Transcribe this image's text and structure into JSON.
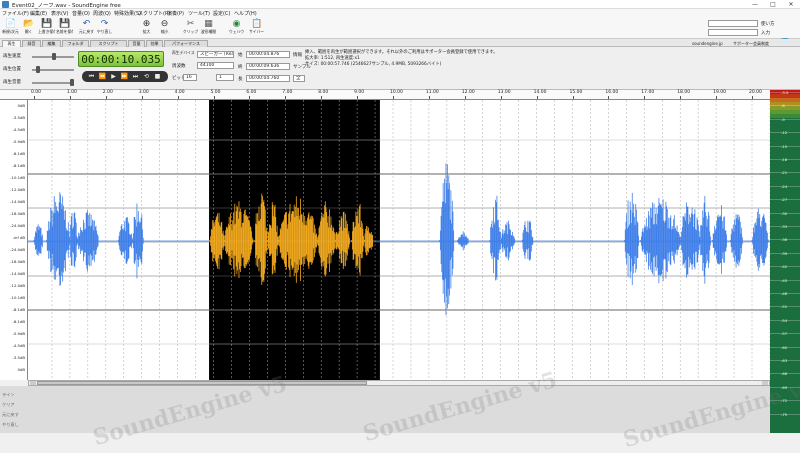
{
  "window": {
    "title": "Event02_ノーフ.wav - SoundEngine free",
    "min": "—",
    "max": "□",
    "close": "✕"
  },
  "menu": [
    "ファイル(F)",
    "編集(E)",
    "表示(V)",
    "音量(O)",
    "周波(Q)",
    "特殊効果(S)",
    "スクリプト(R)",
    "演奏(P)",
    "ツール(T)",
    "設定(C)",
    "ヘルプ(H)"
  ],
  "toolbar": [
    {
      "icon": "📄",
      "label": "新規/次元",
      "color": "#555"
    },
    {
      "icon": "📂",
      "label": "開く",
      "color": "#d4a020"
    },
    {
      "icon": "💾",
      "label": "上書き保存",
      "color": "#3a6fb0"
    },
    {
      "icon": "💾",
      "label": "名前を保存",
      "color": "#3a6fb0"
    },
    {
      "icon": "↶",
      "label": "元に戻す",
      "color": "#2a5fb0"
    },
    {
      "icon": "↷",
      "label": "やり直し",
      "color": "#2a5fb0"
    },
    {
      "icon": "⊕",
      "label": "拡大",
      "color": "#333"
    },
    {
      "icon": "⊖",
      "label": "縮小",
      "color": "#333"
    },
    {
      "icon": "✂",
      "label": "クリップ",
      "color": "#555"
    },
    {
      "icon": "▦",
      "label": "波形補間",
      "color": "#555"
    },
    {
      "icon": "◉",
      "label": "ウェハウ",
      "color": "#1f8c3a"
    },
    {
      "icon": "📋",
      "label": "サイバー",
      "color": "#555"
    }
  ],
  "right_header": {
    "field1": "",
    "field2": "",
    "label1": "使い方",
    "label2": "入力",
    "brand": "soundengine.jp",
    "member": "サポーター会員制度"
  },
  "tabs": [
    "再生",
    "録音",
    "編集",
    "フォルダ",
    "スクリプト",
    "音量",
    "効果",
    "パフォーマンス"
  ],
  "controls": {
    "labels": [
      "再生速度",
      "再生位置",
      "再生音量"
    ],
    "main_time": "00:00:10.035",
    "device_label": "再生デバイス",
    "device_value": "スピーカー (Realt",
    "rate_label": "周波数",
    "rate_value": "44100",
    "bits_label": "ビット",
    "bits_value": "16",
    "ch_value": "1",
    "mode_value": "全",
    "t_start_label": "始",
    "t_start": "00:00:04.876",
    "t_end_label": "終",
    "t_end": "00:00:09.636",
    "t_len_label": "長",
    "t_len": "00:00:04.760",
    "info_tag": "情報",
    "sample_tag": "サンプル"
  },
  "transport": [
    "⏮",
    "⏪",
    "▶",
    "⏩",
    "⏭",
    "⟲",
    "■"
  ],
  "info": [
    "挿入、範囲を再生が範囲選択ができます。それ以外のご利用はサポーター会員登録で使用できます。",
    "拡大率: 1:512, 再生速度:x1",
    "サイズ: 00:00:57.746 (2546627サンプル, 4.9MB, 5093266バイト)"
  ],
  "ruler": [
    "0.00",
    "1.00",
    "2.00",
    "3.00",
    "4.00",
    "5.00",
    "6.00",
    "7.00",
    "8.00",
    "9.00",
    "10.00",
    "11.00",
    "12.00",
    "13.00",
    "14.00",
    "15.00",
    "16.00",
    "17.00",
    "18.00",
    "19.00",
    "20.00"
  ],
  "db_labels": [
    "0dB",
    "-3.5dB",
    "-4.5dB",
    "-5.9dB",
    "-6.1dB",
    "-8.1dB",
    "-10.1dB",
    "-12.0dB",
    "-14.0dB",
    "-18.0dB",
    "-24.0dB",
    "-inf dB",
    "-24.0dB",
    "-18.0dB",
    "-14.0dB",
    "-12.0dB",
    "-10.1dB",
    "-8.1dB",
    "-6.1dB",
    "-5.9dB",
    "-4.5dB",
    "-3.5dB",
    "0dB"
  ],
  "meter_labels": [
    "-3.5",
    "-6",
    "-9",
    "-12",
    "-15",
    "-18",
    "-21",
    "-24",
    "-27",
    "-30",
    "-33",
    "-36",
    "-39",
    "-42",
    "-45",
    "-48",
    "-51",
    "-54",
    "-57",
    "-60",
    "-63",
    "-66",
    "-69",
    "-72",
    "-75"
  ],
  "side_labels": [
    "ライン",
    "クリア",
    "元に戻す",
    "やり直し"
  ],
  "watermark": "SoundEngine v5",
  "colors": {
    "wave": "#3f7fe8",
    "selected_wave": "#f0a81e",
    "selection_bg": "#000000",
    "timebox": "#8fd14a"
  },
  "selection": {
    "start_s": 4.876,
    "end_s": 9.636
  }
}
